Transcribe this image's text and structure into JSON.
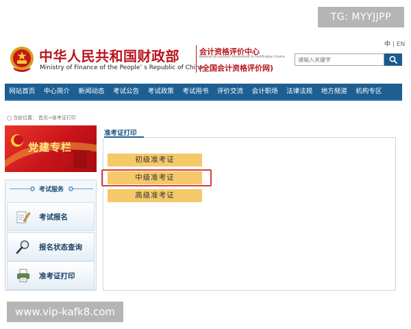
{
  "overlays": {
    "tg": "TG: MYYJJPP",
    "url": "www.vip-kafk8.com"
  },
  "lang": {
    "zh": "中",
    "sep": " | ",
    "en": "EN"
  },
  "header": {
    "ministry_cn": "中华人民共和国财政部",
    "ministry_en": "Ministry of Finance of the People’ s Republic of China",
    "center_cn": "会计资格评价中心",
    "center_en": "National Accountant Assessment & Certification Centre",
    "center_sub": "(全国会计资格评价网)"
  },
  "search": {
    "placeholder": "请输入关键字",
    "icon": "search-icon"
  },
  "nav": [
    "网站首页",
    "中心简介",
    "新闻动态",
    "考试公告",
    "考试政策",
    "考试用书",
    "评价交流",
    "会计职场",
    "法律法规",
    "地方频道",
    "机构专区"
  ],
  "breadcrumb": {
    "prefix": "当前位置：",
    "path": "首页→准考证打印"
  },
  "banner": {
    "label": "党建专栏"
  },
  "service": {
    "title": "考试服务",
    "items": [
      {
        "label": "考试报名",
        "icon": "registration-pencil-icon"
      },
      {
        "label": "报名状态查询",
        "icon": "magnifier-icon"
      },
      {
        "label": "准考证打印",
        "icon": "printer-icon"
      }
    ]
  },
  "panel": {
    "tab": "准考证打印",
    "buttons": [
      "初级准考证",
      "中级准考证",
      "高级准考证"
    ],
    "highlighted_index": 1
  },
  "colors": {
    "nav": "#1d5f93",
    "brand_red": "#b8151b",
    "button": "#f5c96a",
    "highlight": "#d9393a"
  }
}
